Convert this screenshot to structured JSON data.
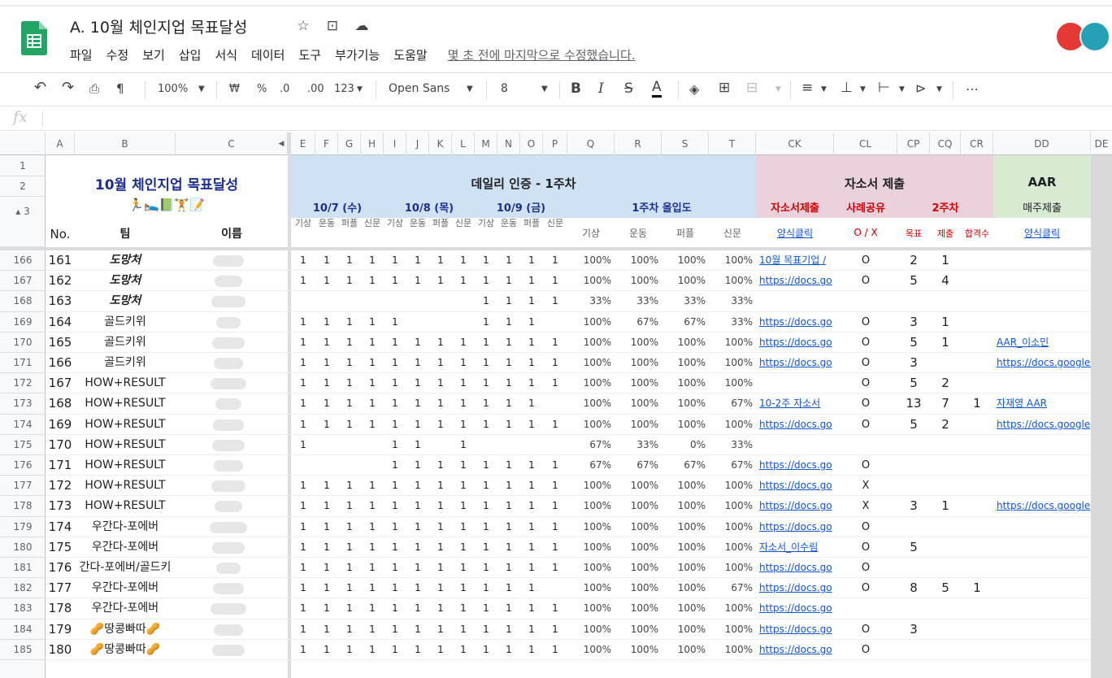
{
  "doc": {
    "title": "A. 10월 체인지업 목표달성",
    "icons": [
      "star-icon",
      "move-folder-icon",
      "cloud-status-icon"
    ]
  },
  "menu": [
    "파일",
    "수정",
    "보기",
    "삽입",
    "서식",
    "데이터",
    "도구",
    "부가기능",
    "도움말"
  ],
  "last_edit": "몇 초 전에 마지막으로 수정했습니다.",
  "toolbar": {
    "zoom": "100%",
    "currency": "₩",
    "percent": "%",
    "dec_less": ".0",
    "dec_more": ".00",
    "more_formats": "123",
    "font": "Open Sans",
    "size": "8",
    "bold": "B",
    "italic": "I",
    "strike": "S",
    "text_color": "A",
    "more": "⋯"
  },
  "formula_bar": {
    "fx": "fx",
    "value": ""
  },
  "columns": {
    "A": "A",
    "B": "B",
    "C": "C",
    "E": "E",
    "F": "F",
    "G": "G",
    "H": "H",
    "I": "I",
    "J": "J",
    "K": "K",
    "L": "L",
    "M": "M",
    "N": "N",
    "O": "O",
    "P": "P",
    "Q": "Q",
    "R": "R",
    "S": "S",
    "T": "T",
    "CK": "CK",
    "CL": "CL",
    "CP": "CP",
    "CQ": "CQ",
    "CR": "CR",
    "DD": "DD",
    "DE": "DE"
  },
  "header": {
    "title": "10월 체인지업 목표달성",
    "emoji": "🏃🛌📗🏋📝",
    "no": "No.",
    "team": "팀",
    "name": "이름",
    "daily": "데일리 인증 - 1주차",
    "d1": "10/7 (수)",
    "d2": "10/8 (목)",
    "d3": "10/9 (금)",
    "weekly": "1주차 올입도",
    "sub_labels": [
      "기상",
      "운동",
      "퍼플",
      "신문"
    ],
    "week_cols": [
      "기상",
      "운동",
      "퍼플",
      "신문"
    ],
    "essay": "자소서 제출",
    "essay_sub": "자소서제출",
    "case_share": "사례공유",
    "week2": "2주차",
    "aar": "AAR",
    "aar_sub": "매주제출",
    "form_link": "양식클릭",
    "ox": "O / X",
    "goal": "목표",
    "submit": "제출",
    "pass": "합격수",
    "aar_form": "양식클릭"
  },
  "rows": [
    {
      "r": "166",
      "no": "161",
      "team": "도망처",
      "italic": true,
      "d": [
        "1",
        "1",
        "1",
        "1",
        "1",
        "1",
        "1",
        "1",
        "1",
        "1",
        "1",
        "1"
      ],
      "w": [
        "100%",
        "100%",
        "100%",
        "100%"
      ],
      "link": "10월 목표기업 /",
      "ox": "O",
      "goal": "2",
      "sub": "1",
      "pass": "",
      "aar": ""
    },
    {
      "r": "167",
      "no": "162",
      "team": "도망처",
      "italic": true,
      "d": [
        "1",
        "1",
        "1",
        "1",
        "1",
        "1",
        "1",
        "1",
        "1",
        "1",
        "1",
        "1"
      ],
      "w": [
        "100%",
        "100%",
        "100%",
        "100%"
      ],
      "link": "https://docs.go",
      "ox": "O",
      "goal": "5",
      "sub": "4",
      "pass": "",
      "aar": ""
    },
    {
      "r": "168",
      "no": "163",
      "team": "도망처",
      "italic": true,
      "d": [
        "",
        "",
        "",
        "",
        "",
        "",
        "",
        "",
        "1",
        "1",
        "1",
        "1"
      ],
      "w": [
        "33%",
        "33%",
        "33%",
        "33%"
      ],
      "link": "",
      "ox": "",
      "goal": "",
      "sub": "",
      "pass": "",
      "aar": ""
    },
    {
      "r": "169",
      "no": "164",
      "team": "골드키위",
      "d": [
        "1",
        "1",
        "1",
        "1",
        "1",
        "",
        "",
        "",
        "1",
        "1",
        "1",
        ""
      ],
      "w": [
        "100%",
        "67%",
        "67%",
        "33%"
      ],
      "link": "https://docs.go",
      "ox": "O",
      "goal": "3",
      "sub": "1",
      "pass": "",
      "aar": ""
    },
    {
      "r": "170",
      "no": "165",
      "team": "골드키위",
      "d": [
        "1",
        "1",
        "1",
        "1",
        "1",
        "1",
        "1",
        "1",
        "1",
        "1",
        "1",
        "1"
      ],
      "w": [
        "100%",
        "100%",
        "100%",
        "100%"
      ],
      "link": "https://docs.go",
      "ox": "O",
      "goal": "5",
      "sub": "1",
      "pass": "",
      "aar": "AAR_이소민"
    },
    {
      "r": "171",
      "no": "166",
      "team": "골드키위",
      "d": [
        "1",
        "1",
        "1",
        "1",
        "1",
        "1",
        "1",
        "1",
        "1",
        "1",
        "1",
        "1"
      ],
      "w": [
        "100%",
        "100%",
        "100%",
        "100%"
      ],
      "link": "https://docs.go",
      "ox": "O",
      "goal": "3",
      "sub": "",
      "pass": "",
      "aar": "https://docs.google.com"
    },
    {
      "r": "172",
      "no": "167",
      "team": "HOW+RESULT",
      "d": [
        "1",
        "1",
        "1",
        "1",
        "1",
        "1",
        "1",
        "1",
        "1",
        "1",
        "1",
        "1"
      ],
      "w": [
        "100%",
        "100%",
        "100%",
        "100%"
      ],
      "link": "",
      "ox": "O",
      "goal": "5",
      "sub": "2",
      "pass": "",
      "aar": ""
    },
    {
      "r": "173",
      "no": "168",
      "team": "HOW+RESULT",
      "d": [
        "1",
        "1",
        "1",
        "1",
        "1",
        "1",
        "1",
        "1",
        "1",
        "1",
        "1",
        ""
      ],
      "w": [
        "100%",
        "100%",
        "100%",
        "67%"
      ],
      "link": "10-2주 자소서",
      "ox": "O",
      "goal": "13",
      "sub": "7",
      "pass": "1",
      "aar": "자재영 AAR"
    },
    {
      "r": "174",
      "no": "169",
      "team": "HOW+RESULT",
      "d": [
        "1",
        "1",
        "1",
        "1",
        "1",
        "1",
        "1",
        "1",
        "1",
        "1",
        "1",
        "1"
      ],
      "w": [
        "100%",
        "100%",
        "100%",
        "100%"
      ],
      "link": "https://docs.go",
      "ox": "O",
      "goal": "5",
      "sub": "2",
      "pass": "",
      "aar": "https://docs.google"
    },
    {
      "r": "175",
      "no": "170",
      "team": "HOW+RESULT",
      "d": [
        "1",
        "",
        "",
        "",
        "1",
        "1",
        "",
        "1",
        "",
        "",
        "",
        ""
      ],
      "w": [
        "67%",
        "33%",
        "0%",
        "33%"
      ],
      "link": "",
      "ox": "",
      "goal": "",
      "sub": "",
      "pass": "",
      "aar": ""
    },
    {
      "r": "176",
      "no": "171",
      "team": "HOW+RESULT",
      "d": [
        "",
        "",
        "",
        "",
        "1",
        "1",
        "1",
        "1",
        "1",
        "1",
        "1",
        "1"
      ],
      "w": [
        "67%",
        "67%",
        "67%",
        "67%"
      ],
      "link": "https://docs.go",
      "ox": "O",
      "goal": "",
      "sub": "",
      "pass": "",
      "aar": ""
    },
    {
      "r": "177",
      "no": "172",
      "team": "HOW+RESULT",
      "d": [
        "1",
        "1",
        "1",
        "1",
        "1",
        "1",
        "1",
        "1",
        "1",
        "1",
        "1",
        "1"
      ],
      "w": [
        "100%",
        "100%",
        "100%",
        "100%"
      ],
      "link": "https://docs.go",
      "ox": "X",
      "goal": "",
      "sub": "",
      "pass": "",
      "aar": ""
    },
    {
      "r": "178",
      "no": "173",
      "team": "HOW+RESULT",
      "d": [
        "1",
        "1",
        "1",
        "1",
        "1",
        "1",
        "1",
        "1",
        "1",
        "1",
        "1",
        "1"
      ],
      "w": [
        "100%",
        "100%",
        "100%",
        "100%"
      ],
      "link": "https://docs.go",
      "ox": "X",
      "goal": "3",
      "sub": "1",
      "pass": "",
      "aar": "https://docs.google"
    },
    {
      "r": "179",
      "no": "174",
      "team": "우간다-포에버",
      "d": [
        "1",
        "1",
        "1",
        "1",
        "1",
        "1",
        "1",
        "1",
        "1",
        "1",
        "1",
        "1"
      ],
      "w": [
        "100%",
        "100%",
        "100%",
        "100%"
      ],
      "link": "https://docs.go",
      "ox": "O",
      "goal": "",
      "sub": "",
      "pass": "",
      "aar": ""
    },
    {
      "r": "180",
      "no": "175",
      "team": "우간다-포에버",
      "d": [
        "1",
        "1",
        "1",
        "1",
        "1",
        "1",
        "1",
        "1",
        "1",
        "1",
        "1",
        "1"
      ],
      "w": [
        "100%",
        "100%",
        "100%",
        "100%"
      ],
      "link": "자소서_이수림",
      "ox": "O",
      "goal": "5",
      "sub": "",
      "pass": "",
      "aar": ""
    },
    {
      "r": "181",
      "no": "176",
      "team": "간다-포에버/골드키",
      "d": [
        "1",
        "1",
        "1",
        "1",
        "1",
        "1",
        "1",
        "1",
        "1",
        "1",
        "1",
        "1"
      ],
      "w": [
        "100%",
        "100%",
        "100%",
        "100%"
      ],
      "link": "https://docs.go",
      "ox": "O",
      "goal": "",
      "sub": "",
      "pass": "",
      "aar": ""
    },
    {
      "r": "182",
      "no": "177",
      "team": "우간다-포에버",
      "d": [
        "1",
        "1",
        "1",
        "1",
        "1",
        "1",
        "1",
        "1",
        "1",
        "1",
        "1",
        ""
      ],
      "w": [
        "100%",
        "100%",
        "100%",
        "67%"
      ],
      "link": "https://docs.go",
      "ox": "O",
      "goal": "8",
      "sub": "5",
      "pass": "1",
      "aar": ""
    },
    {
      "r": "183",
      "no": "178",
      "team": "우간다-포에버",
      "d": [
        "1",
        "1",
        "1",
        "1",
        "1",
        "1",
        "1",
        "1",
        "1",
        "1",
        "1",
        "1"
      ],
      "w": [
        "100%",
        "100%",
        "100%",
        "100%"
      ],
      "link": "https://docs.go",
      "ox": "",
      "goal": "",
      "sub": "",
      "pass": "",
      "aar": ""
    },
    {
      "r": "184",
      "no": "179",
      "team": "🥜땅콩빠따🥜",
      "d": [
        "1",
        "1",
        "1",
        "1",
        "1",
        "1",
        "1",
        "1",
        "1",
        "1",
        "1",
        "1"
      ],
      "w": [
        "100%",
        "100%",
        "100%",
        "100%"
      ],
      "link": "https://docs.go",
      "ox": "O",
      "goal": "3",
      "sub": "",
      "pass": "",
      "aar": ""
    },
    {
      "r": "185",
      "no": "180",
      "team": "🥜땅콩빠따🥜",
      "d": [
        "1",
        "1",
        "1",
        "1",
        "1",
        "1",
        "1",
        "1",
        "1",
        "1",
        "1",
        "1"
      ],
      "w": [
        "100%",
        "100%",
        "100%",
        "100%"
      ],
      "link": "https://docs.go",
      "ox": "O",
      "goal": "",
      "sub": "",
      "pass": "",
      "aar": ""
    }
  ],
  "colors": {
    "blue_band": "#cfe2f3",
    "pink_band": "#ead1dc",
    "green_band": "#d9ead3",
    "title_navy": "#1c2f8c",
    "red_text": "#cc0000",
    "link": "#1155cc"
  }
}
